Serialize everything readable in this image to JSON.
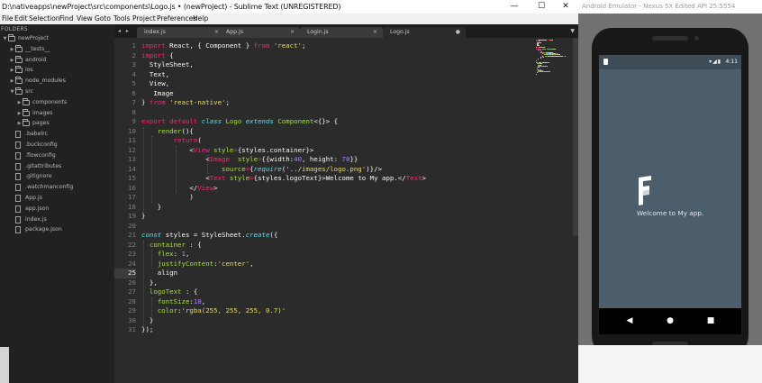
{
  "sublime": {
    "title": "D:\\nativeapps\\newProject\\src\\components\\Logo.js • (newProject) - Sublime Text (UNREGISTERED)",
    "window_controls": {
      "minimize": "—",
      "maximize": "☐",
      "close": "✕"
    },
    "menu": [
      "File",
      "Edit",
      "Selection",
      "Find",
      "View",
      "Goto",
      "Tools",
      "Project",
      "Preferences",
      "Help"
    ],
    "sidebar": {
      "header": "FOLDERS",
      "items": [
        {
          "type": "folder",
          "name": "newProject",
          "open": true,
          "level": 0
        },
        {
          "type": "folder",
          "name": "__tests__",
          "open": false,
          "level": 1
        },
        {
          "type": "folder",
          "name": "android",
          "open": false,
          "level": 1
        },
        {
          "type": "folder",
          "name": "ios",
          "open": false,
          "level": 1
        },
        {
          "type": "folder",
          "name": "node_modules",
          "open": false,
          "level": 1
        },
        {
          "type": "folder",
          "name": "src",
          "open": true,
          "level": 1
        },
        {
          "type": "folder",
          "name": "components",
          "open": false,
          "level": 2
        },
        {
          "type": "folder",
          "name": "images",
          "open": false,
          "level": 2
        },
        {
          "type": "folder",
          "name": "pages",
          "open": false,
          "level": 2
        },
        {
          "type": "file",
          "name": ".babelrc",
          "level": 1
        },
        {
          "type": "file",
          "name": ".buckconfig",
          "level": 1
        },
        {
          "type": "file",
          "name": ".flowconfig",
          "level": 1
        },
        {
          "type": "file",
          "name": ".gitattributes",
          "level": 1
        },
        {
          "type": "file",
          "name": ".gitignore",
          "level": 1
        },
        {
          "type": "file",
          "name": ".watchmanconfig",
          "level": 1
        },
        {
          "type": "file",
          "name": "App.js",
          "level": 1
        },
        {
          "type": "file",
          "name": "app.json",
          "level": 1
        },
        {
          "type": "file",
          "name": "index.js",
          "level": 1
        },
        {
          "type": "file",
          "name": "package.json",
          "level": 1
        }
      ]
    },
    "tab_nav": "◂ ▸",
    "tabs": [
      {
        "label": "index.js",
        "close": "×",
        "active": false
      },
      {
        "label": "App.js",
        "close": "×",
        "active": false
      },
      {
        "label": "Login.js",
        "close": "×",
        "active": false
      },
      {
        "label": "Logo.js",
        "close": "●",
        "active": true
      }
    ],
    "tab_dropdown": "▼",
    "editor": {
      "current_line": 25,
      "colors": {
        "keyword": "#f92672",
        "string": "#e6db74",
        "type": "#66d9ef",
        "number": "#ae81ff",
        "function": "#a6e22e",
        "plain": "#f8f8f2",
        "tag": "#f92672",
        "attr": "#a6e22e"
      },
      "lines": [
        [
          [
            "import",
            "kw"
          ],
          [
            " React, { Component } ",
            "p"
          ],
          [
            "from",
            "kw"
          ],
          [
            " ",
            "p"
          ],
          [
            "'react'",
            "s"
          ],
          [
            ";",
            "p"
          ]
        ],
        [
          [
            "import",
            "kw"
          ],
          [
            " {",
            "p"
          ]
        ],
        [
          [
            "  StyleSheet,",
            "p"
          ]
        ],
        [
          [
            "  Text,",
            "p"
          ]
        ],
        [
          [
            "  View,",
            "p"
          ]
        ],
        [
          [
            "   Image",
            "p"
          ]
        ],
        [
          [
            "} ",
            "p"
          ],
          [
            "from",
            "kw"
          ],
          [
            " ",
            "p"
          ],
          [
            "'react-native'",
            "s"
          ],
          [
            ";",
            "p"
          ]
        ],
        [
          [
            "",
            "p"
          ]
        ],
        [
          [
            "export",
            "kw"
          ],
          [
            " ",
            "p"
          ],
          [
            "default",
            "kw"
          ],
          [
            " ",
            "p"
          ],
          [
            "class",
            "ty"
          ],
          [
            " ",
            "p"
          ],
          [
            "Logo",
            "fn"
          ],
          [
            " ",
            "p"
          ],
          [
            "extends",
            "ty"
          ],
          [
            " ",
            "p"
          ],
          [
            "Component",
            "fn"
          ],
          [
            "<{}> {",
            "p"
          ]
        ],
        [
          [
            "    ",
            "p"
          ],
          [
            "render",
            "fn"
          ],
          [
            "(){",
            "p"
          ]
        ],
        [
          [
            "        ",
            "p"
          ],
          [
            "return",
            "kw"
          ],
          [
            "(",
            "p"
          ]
        ],
        [
          [
            "            <",
            "p"
          ],
          [
            "View",
            "tag"
          ],
          [
            " ",
            "p"
          ],
          [
            "style",
            "attr"
          ],
          [
            "=",
            "kw"
          ],
          [
            "{styles.container}>",
            "p"
          ]
        ],
        [
          [
            "                <",
            "p"
          ],
          [
            "Image",
            "tag"
          ],
          [
            "  ",
            "p"
          ],
          [
            "style",
            "attr"
          ],
          [
            "=",
            "kw"
          ],
          [
            "{{width:",
            "p"
          ],
          [
            "40",
            "num"
          ],
          [
            ", height: ",
            "p"
          ],
          [
            "70",
            "num"
          ],
          [
            "}}",
            "p"
          ]
        ],
        [
          [
            "                    ",
            "p"
          ],
          [
            "source",
            "attr"
          ],
          [
            "=",
            "kw"
          ],
          [
            "{",
            "p"
          ],
          [
            "require",
            "ty"
          ],
          [
            "(",
            "p"
          ],
          [
            "'../images/logo.png'",
            "s"
          ],
          [
            ")}/>",
            "p"
          ]
        ],
        [
          [
            "                <",
            "p"
          ],
          [
            "Text",
            "tag"
          ],
          [
            " ",
            "p"
          ],
          [
            "style",
            "attr"
          ],
          [
            "=",
            "kw"
          ],
          [
            "{styles.logoText}>Welcome to My app.</",
            "p"
          ],
          [
            "Text",
            "tag"
          ],
          [
            ">",
            "p"
          ]
        ],
        [
          [
            "            </",
            "p"
          ],
          [
            "View",
            "tag"
          ],
          [
            ">",
            "p"
          ]
        ],
        [
          [
            "            )",
            "p"
          ]
        ],
        [
          [
            "    }",
            "p"
          ]
        ],
        [
          [
            "}",
            "p"
          ]
        ],
        [
          [
            "",
            "p"
          ]
        ],
        [
          [
            "const",
            "ty"
          ],
          [
            " styles = ",
            "p"
          ],
          [
            "StyleSheet",
            "p"
          ],
          [
            ".",
            "p"
          ],
          [
            "create",
            "ty"
          ],
          [
            "({",
            "p"
          ]
        ],
        [
          [
            "  ",
            "p"
          ],
          [
            "container",
            "fn"
          ],
          [
            " : {",
            "p"
          ]
        ],
        [
          [
            "    ",
            "p"
          ],
          [
            "flex",
            "fn"
          ],
          [
            ": ",
            "p"
          ],
          [
            "1",
            "num"
          ],
          [
            ",",
            "p"
          ]
        ],
        [
          [
            "    ",
            "p"
          ],
          [
            "justifyContent",
            "fn"
          ],
          [
            ":",
            "p"
          ],
          [
            "'center'",
            "s"
          ],
          [
            ",",
            "p"
          ]
        ],
        [
          [
            "    align",
            "p"
          ]
        ],
        [
          [
            "  },",
            "p"
          ]
        ],
        [
          [
            "  ",
            "p"
          ],
          [
            "logoText",
            "fn"
          ],
          [
            " : {",
            "p"
          ]
        ],
        [
          [
            "    ",
            "p"
          ],
          [
            "fontSize",
            "fn"
          ],
          [
            ":",
            "p"
          ],
          [
            "18",
            "num"
          ],
          [
            ",",
            "p"
          ]
        ],
        [
          [
            "    ",
            "p"
          ],
          [
            "color",
            "fn"
          ],
          [
            ":",
            "p"
          ],
          [
            "'rgba(255, 255, 255, 0.7)'",
            "s"
          ]
        ],
        [
          [
            "  }",
            "p"
          ]
        ],
        [
          [
            "});",
            "p"
          ]
        ]
      ]
    }
  },
  "emulator": {
    "title": "Android Emulator - Nexus 5X Edited API 25:5554",
    "status_icons": "▾◢▮",
    "time": "4:11",
    "app_text": "Welcome to My app.",
    "nav": {
      "back": "◀",
      "home": "●",
      "recents": "■"
    }
  }
}
